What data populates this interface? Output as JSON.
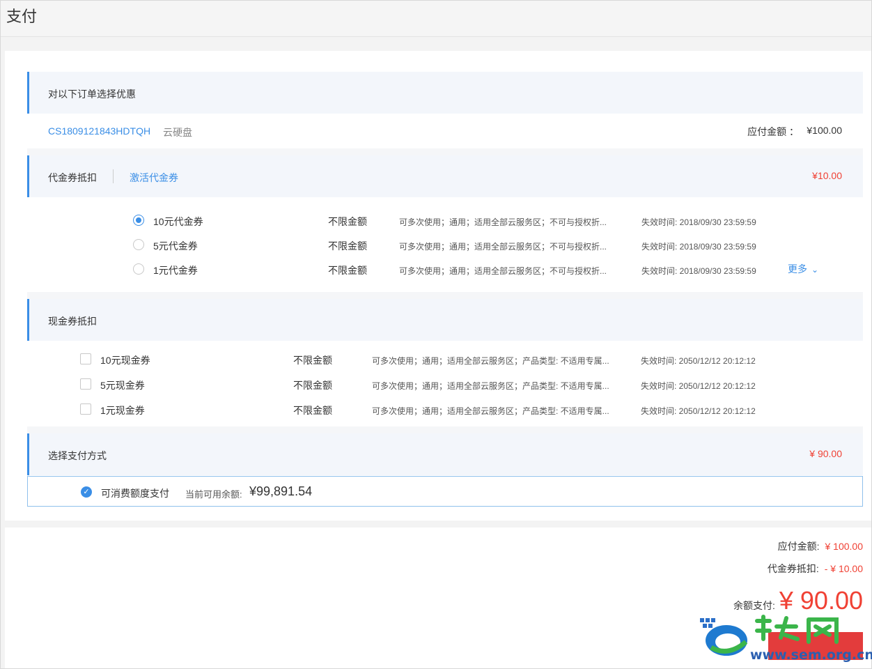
{
  "page": {
    "title": "支付"
  },
  "order_section": {
    "heading": "对以下订单选择优惠",
    "order_id": "CS1809121843HDTQH",
    "product": "云硬盘",
    "amount_label": "应付金额 ：",
    "amount": "¥100.00"
  },
  "voucher_section": {
    "heading": "代金券抵扣",
    "activate_link": "激活代金券",
    "amount": "¥10.00",
    "items": [
      {
        "name": "10元代金券",
        "limit": "不限金额",
        "desc": "可多次使用；通用；适用全部云服务区；不可与授权折...",
        "expire": "失效时间: 2018/09/30 23:59:59",
        "selected": true
      },
      {
        "name": "5元代金券",
        "limit": "不限金额",
        "desc": "可多次使用；通用；适用全部云服务区；不可与授权折...",
        "expire": "失效时间: 2018/09/30 23:59:59",
        "selected": false
      },
      {
        "name": "1元代金券",
        "limit": "不限金额",
        "desc": "可多次使用；通用；适用全部云服务区；不可与授权折...",
        "expire": "失效时间: 2018/09/30 23:59:59",
        "selected": false
      }
    ],
    "more_label": "更多"
  },
  "cash_section": {
    "heading": "现金券抵扣",
    "items": [
      {
        "name": "10元现金券",
        "limit": "不限金额",
        "desc": "可多次使用；通用；适用全部云服务区；产品类型: 不适用专属...",
        "expire": "失效时间: 2050/12/12 20:12:12"
      },
      {
        "name": "5元现金券",
        "limit": "不限金额",
        "desc": "可多次使用；通用；适用全部云服务区；产品类型: 不适用专属...",
        "expire": "失效时间: 2050/12/12 20:12:12"
      },
      {
        "name": "1元现金券",
        "limit": "不限金额",
        "desc": "可多次使用；通用；适用全部云服务区；产品类型: 不适用专属...",
        "expire": "失效时间: 2050/12/12 20:12:12"
      }
    ]
  },
  "payment_section": {
    "heading": "选择支付方式",
    "amount": "¥ 90.00",
    "method_label": "可消费额度支付",
    "balance_label": "当前可用余额:",
    "balance_value": "¥99,891.54"
  },
  "summary": {
    "payable_label": "应付金额:",
    "payable_value": "¥ 100.00",
    "voucher_label": "代金券抵扣:",
    "voucher_value": "- ¥ 10.00",
    "total_label": "余额支付:",
    "total_value": "¥ 90.00"
  },
  "watermark": {
    "text": "www.sem.org.cn",
    "logo_text": "站长网"
  },
  "colors": {
    "accent": "#3a8ee6",
    "price": "#f04134",
    "pay_button": "#e33c3c"
  }
}
